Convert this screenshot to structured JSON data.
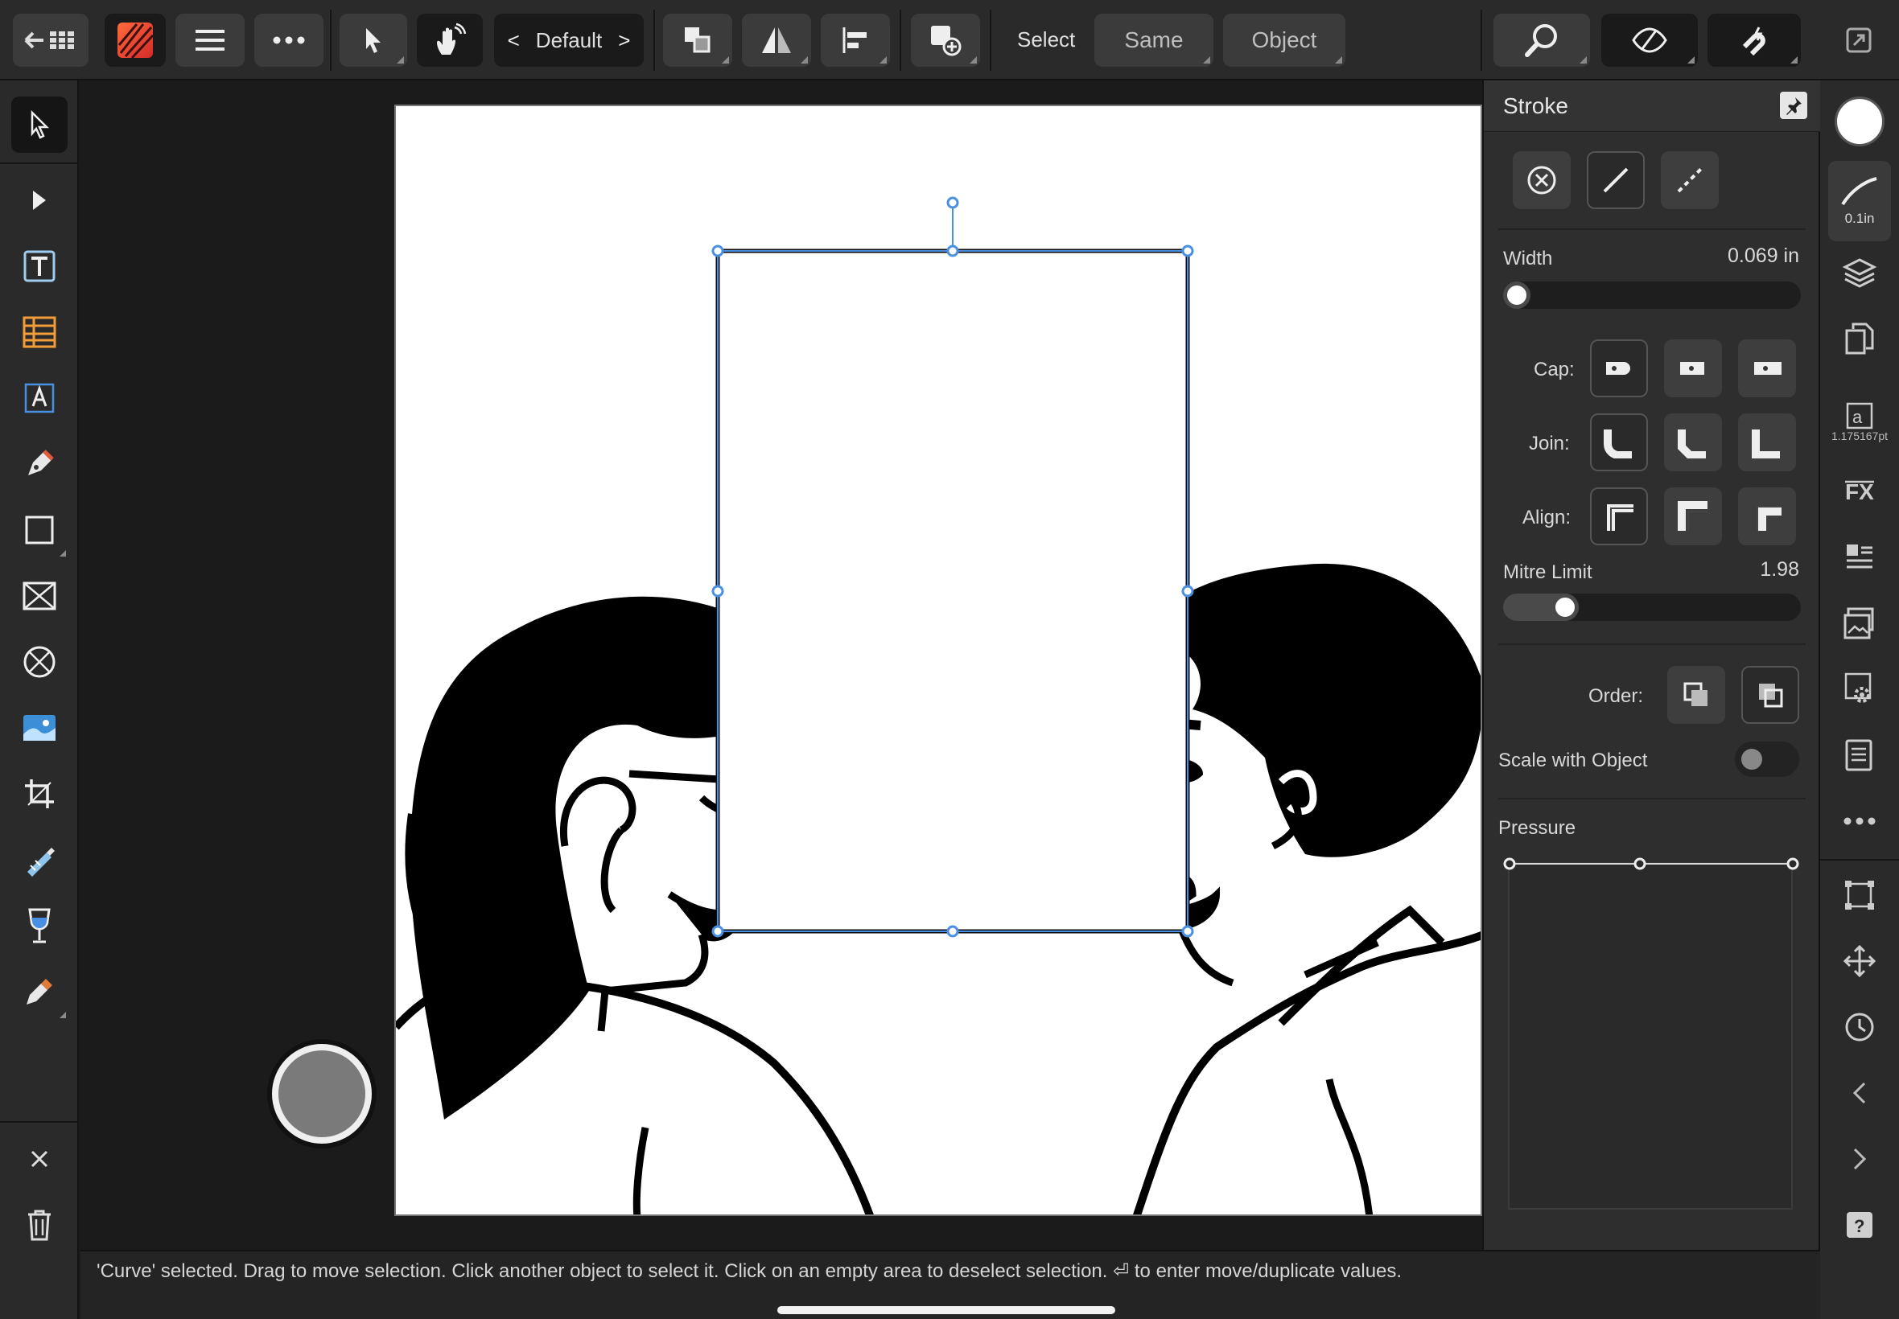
{
  "toolbar": {
    "preset_name": "Default",
    "select_label": "Select",
    "same_label": "Same",
    "object_label": "Object"
  },
  "icons": {
    "back": "back-arrow-grid-icon",
    "app": "affinity-designer-logo",
    "menu": "hamburger-menu-icon",
    "more": "more-dots-icon",
    "move": "move-pointer-icon",
    "gesture": "gesture-hand-icon",
    "arrange": "arrange-icon",
    "flip": "flip-icon",
    "align": "align-icon",
    "add": "add-shape-icon",
    "zoom": "zoom-icon",
    "view": "view-eye-icon",
    "snap": "snap-magnet-icon",
    "fullscreen": "fullscreen-icon"
  },
  "stroke_panel": {
    "title": "Stroke",
    "width_label": "Width",
    "width_value": "0.069 in",
    "width_fraction": 0.0,
    "cap_label": "Cap:",
    "join_label": "Join:",
    "align_label": "Align:",
    "mitre_label": "Mitre Limit",
    "mitre_value": "1.98",
    "mitre_fraction": 0.18,
    "order_label": "Order:",
    "scale_label": "Scale with Object",
    "scale_on": false,
    "pressure_label": "Pressure"
  },
  "studio": {
    "brush_size": "0.1in",
    "text_size": "1.175167pt"
  },
  "status": {
    "text": "'Curve' selected. Drag to move selection. Click another object to select it. Click on an empty area to deselect selection. ⏎ to enter move/duplicate values."
  },
  "colors": {
    "accent": "#4a90e2",
    "panel": "#2e2e2e",
    "toolbar": "#2a2a2a",
    "canvas": "#ffffff"
  }
}
